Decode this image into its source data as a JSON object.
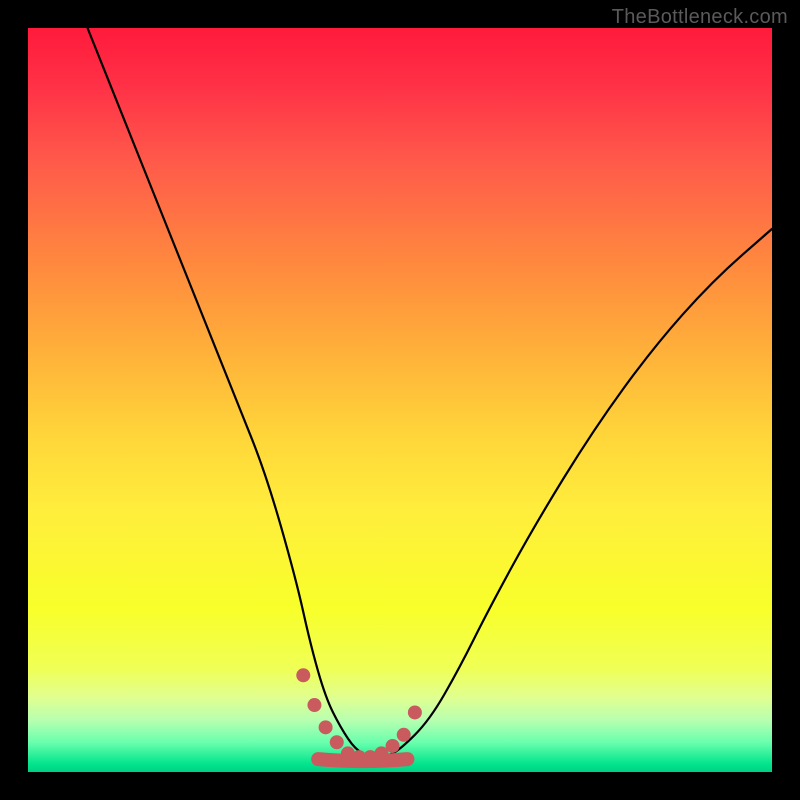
{
  "watermark": "TheBottleneck.com",
  "colors": {
    "frame": "#000000",
    "curve_stroke": "#000000",
    "marker_fill": "#c95b5f",
    "marker_stroke": "#c95b5f"
  },
  "chart_data": {
    "type": "line",
    "title": "",
    "xlabel": "",
    "ylabel": "",
    "xlim": [
      0,
      100
    ],
    "ylim": [
      0,
      100
    ],
    "grid": false,
    "legend": false,
    "series": [
      {
        "name": "bottleneck-curve",
        "x": [
          8,
          12,
          16,
          20,
          24,
          28,
          32,
          36,
          38,
          40,
          42,
          44,
          46,
          48,
          50,
          54,
          58,
          62,
          68,
          76,
          84,
          92,
          100
        ],
        "y": [
          100,
          90,
          80,
          70,
          60,
          50,
          40,
          26,
          17,
          10,
          6,
          3,
          2,
          2,
          3,
          7,
          14,
          22,
          33,
          46,
          57,
          66,
          73
        ]
      }
    ],
    "markers": {
      "name": "valley-markers",
      "x": [
        37,
        38.5,
        40,
        41.5,
        43,
        44.5,
        46,
        47.5,
        49,
        50.5,
        52
      ],
      "y": [
        13,
        9,
        6,
        4,
        2.5,
        2,
        2,
        2.5,
        3.5,
        5,
        8
      ]
    },
    "valley_band": {
      "x_start": 39,
      "x_end": 51,
      "y": 2
    }
  }
}
